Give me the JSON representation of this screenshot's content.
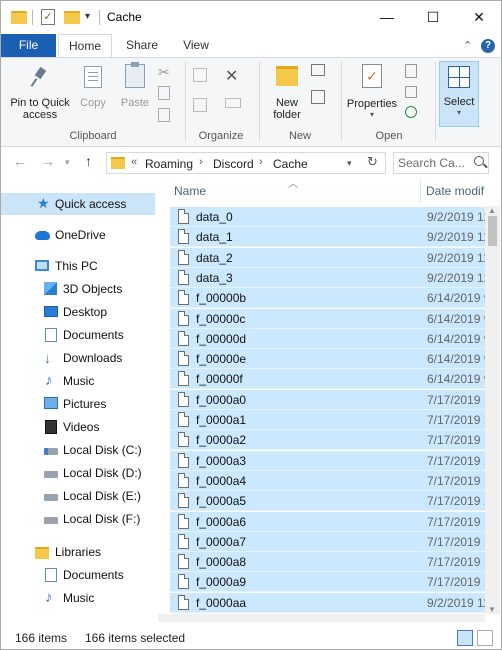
{
  "window": {
    "title": "Cache"
  },
  "window_controls": {
    "minimize": "—",
    "maximize": "☐",
    "close": "✕"
  },
  "ribbon_tabs": [
    {
      "label": "File"
    },
    {
      "label": "Home"
    },
    {
      "label": "Share"
    },
    {
      "label": "View"
    }
  ],
  "ribbon": {
    "clipboard": {
      "label": "Clipboard",
      "pin_to_quick_access": "Pin to Quick access",
      "pin_line1": "Pin to Quick",
      "pin_line2": "access",
      "copy": "Copy",
      "paste": "Paste"
    },
    "organize": {
      "label": "Organize"
    },
    "new": {
      "label": "New",
      "new_folder_line1": "New",
      "new_folder_line2": "folder"
    },
    "open": {
      "label": "Open",
      "properties": "Properties"
    },
    "select": {
      "label": "Select"
    }
  },
  "address": {
    "overflow": "«",
    "crumbs": [
      "Roaming",
      "Discord",
      "Cache"
    ],
    "separator": "›"
  },
  "search": {
    "placeholder": "Search Ca..."
  },
  "nav_pane": {
    "quick_access": "Quick access",
    "onedrive": "OneDrive",
    "this_pc": "This PC",
    "objects_3d": "3D Objects",
    "desktop": "Desktop",
    "documents": "Documents",
    "downloads": "Downloads",
    "music": "Music",
    "pictures": "Pictures",
    "videos": "Videos",
    "local_c": "Local Disk (C:)",
    "local_d": "Local Disk (D:)",
    "local_e": "Local Disk  (E:)",
    "local_f": "Local Disk (F:)",
    "libraries": "Libraries",
    "lib_documents": "Documents",
    "lib_music": "Music"
  },
  "columns": {
    "name": "Name",
    "date": "Date modif"
  },
  "files": [
    {
      "name": "data_0",
      "date": "9/2/2019 12"
    },
    {
      "name": "data_1",
      "date": "9/2/2019 11"
    },
    {
      "name": "data_2",
      "date": "9/2/2019 11"
    },
    {
      "name": "data_3",
      "date": "9/2/2019 12"
    },
    {
      "name": "f_00000b",
      "date": "6/14/2019 9"
    },
    {
      "name": "f_00000c",
      "date": "6/14/2019 9"
    },
    {
      "name": "f_00000d",
      "date": "6/14/2019 9"
    },
    {
      "name": "f_00000e",
      "date": "6/14/2019 9"
    },
    {
      "name": "f_00000f",
      "date": "6/14/2019 9"
    },
    {
      "name": "f_0000a0",
      "date": "7/17/2019 1"
    },
    {
      "name": "f_0000a1",
      "date": "7/17/2019 1"
    },
    {
      "name": "f_0000a2",
      "date": "7/17/2019 1"
    },
    {
      "name": "f_0000a3",
      "date": "7/17/2019 1"
    },
    {
      "name": "f_0000a4",
      "date": "7/17/2019 1"
    },
    {
      "name": "f_0000a5",
      "date": "7/17/2019 1"
    },
    {
      "name": "f_0000a6",
      "date": "7/17/2019 1"
    },
    {
      "name": "f_0000a7",
      "date": "7/17/2019 1"
    },
    {
      "name": "f_0000a8",
      "date": "7/17/2019 1"
    },
    {
      "name": "f_0000a9",
      "date": "7/17/2019 1"
    },
    {
      "name": "f_0000aa",
      "date": "9/2/2019 11"
    }
  ],
  "status": {
    "item_count": "166 items",
    "selected_count": "166 items selected"
  },
  "colors": {
    "accent": "#1a5fb4",
    "selection": "#cce8ff",
    "nav_selection": "#cce4f7"
  }
}
